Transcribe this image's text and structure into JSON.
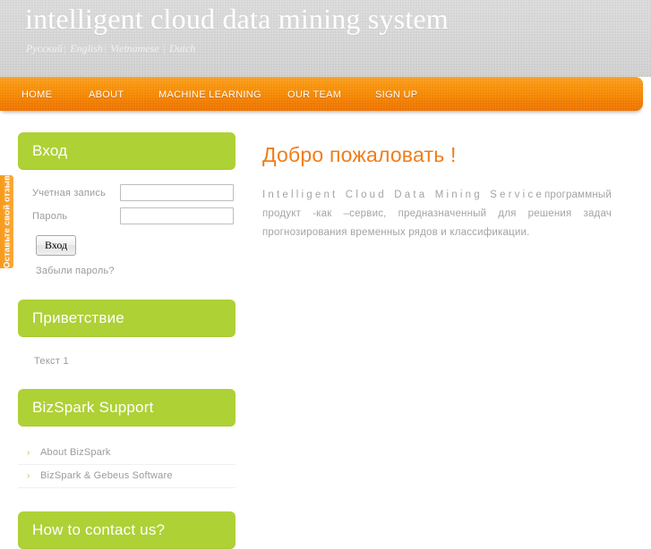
{
  "header": {
    "site_title": "intelligent cloud data mining system",
    "languages": [
      {
        "label": "Русский",
        "sep": "|"
      },
      {
        "label": "English",
        "sep": "|"
      },
      {
        "label": "Vietnamese",
        "sep": "|"
      },
      {
        "label": "Dutch",
        "sep": ""
      }
    ]
  },
  "nav": {
    "items": [
      {
        "label": "HOME"
      },
      {
        "label": "ABOUT"
      },
      {
        "label": "MACHINE LEARNING"
      },
      {
        "label": "OUR TEAM"
      },
      {
        "label": "SIGN UP"
      }
    ]
  },
  "feedback_tab": {
    "label": "Оставьте свой отзыв"
  },
  "sidebar": {
    "login": {
      "title": "Вход",
      "account_label": "Учетная запись",
      "account_value": "",
      "account_placeholder": "",
      "password_label": "Пароль",
      "password_value": "",
      "password_placeholder": "",
      "submit_label": "Вход",
      "forgot_label": "Забыли пароль?"
    },
    "greeting": {
      "title": "Приветствие",
      "text": "Текст 1"
    },
    "bizspark": {
      "title": "BizSpark Support",
      "items": [
        {
          "label": "About BizSpark",
          "chevron": "›"
        },
        {
          "label": "BizSpark & Gebeus Software",
          "chevron": "›"
        }
      ]
    },
    "contact": {
      "title": "How to contact us?"
    }
  },
  "main": {
    "heading": "Добро пожаловать !",
    "paragraph_en": "Intelligent Cloud Data Mining Service",
    "paragraph_ru": "программный продукт -как –сервис, предназначенный для решения задач прогнозирования временных рядов и классификации."
  },
  "colors": {
    "accent_orange": "#f07d1a",
    "panel_green": "#aed136",
    "header_gray": "#d4d4d4",
    "body_text_gray": "#9b9b9b"
  }
}
